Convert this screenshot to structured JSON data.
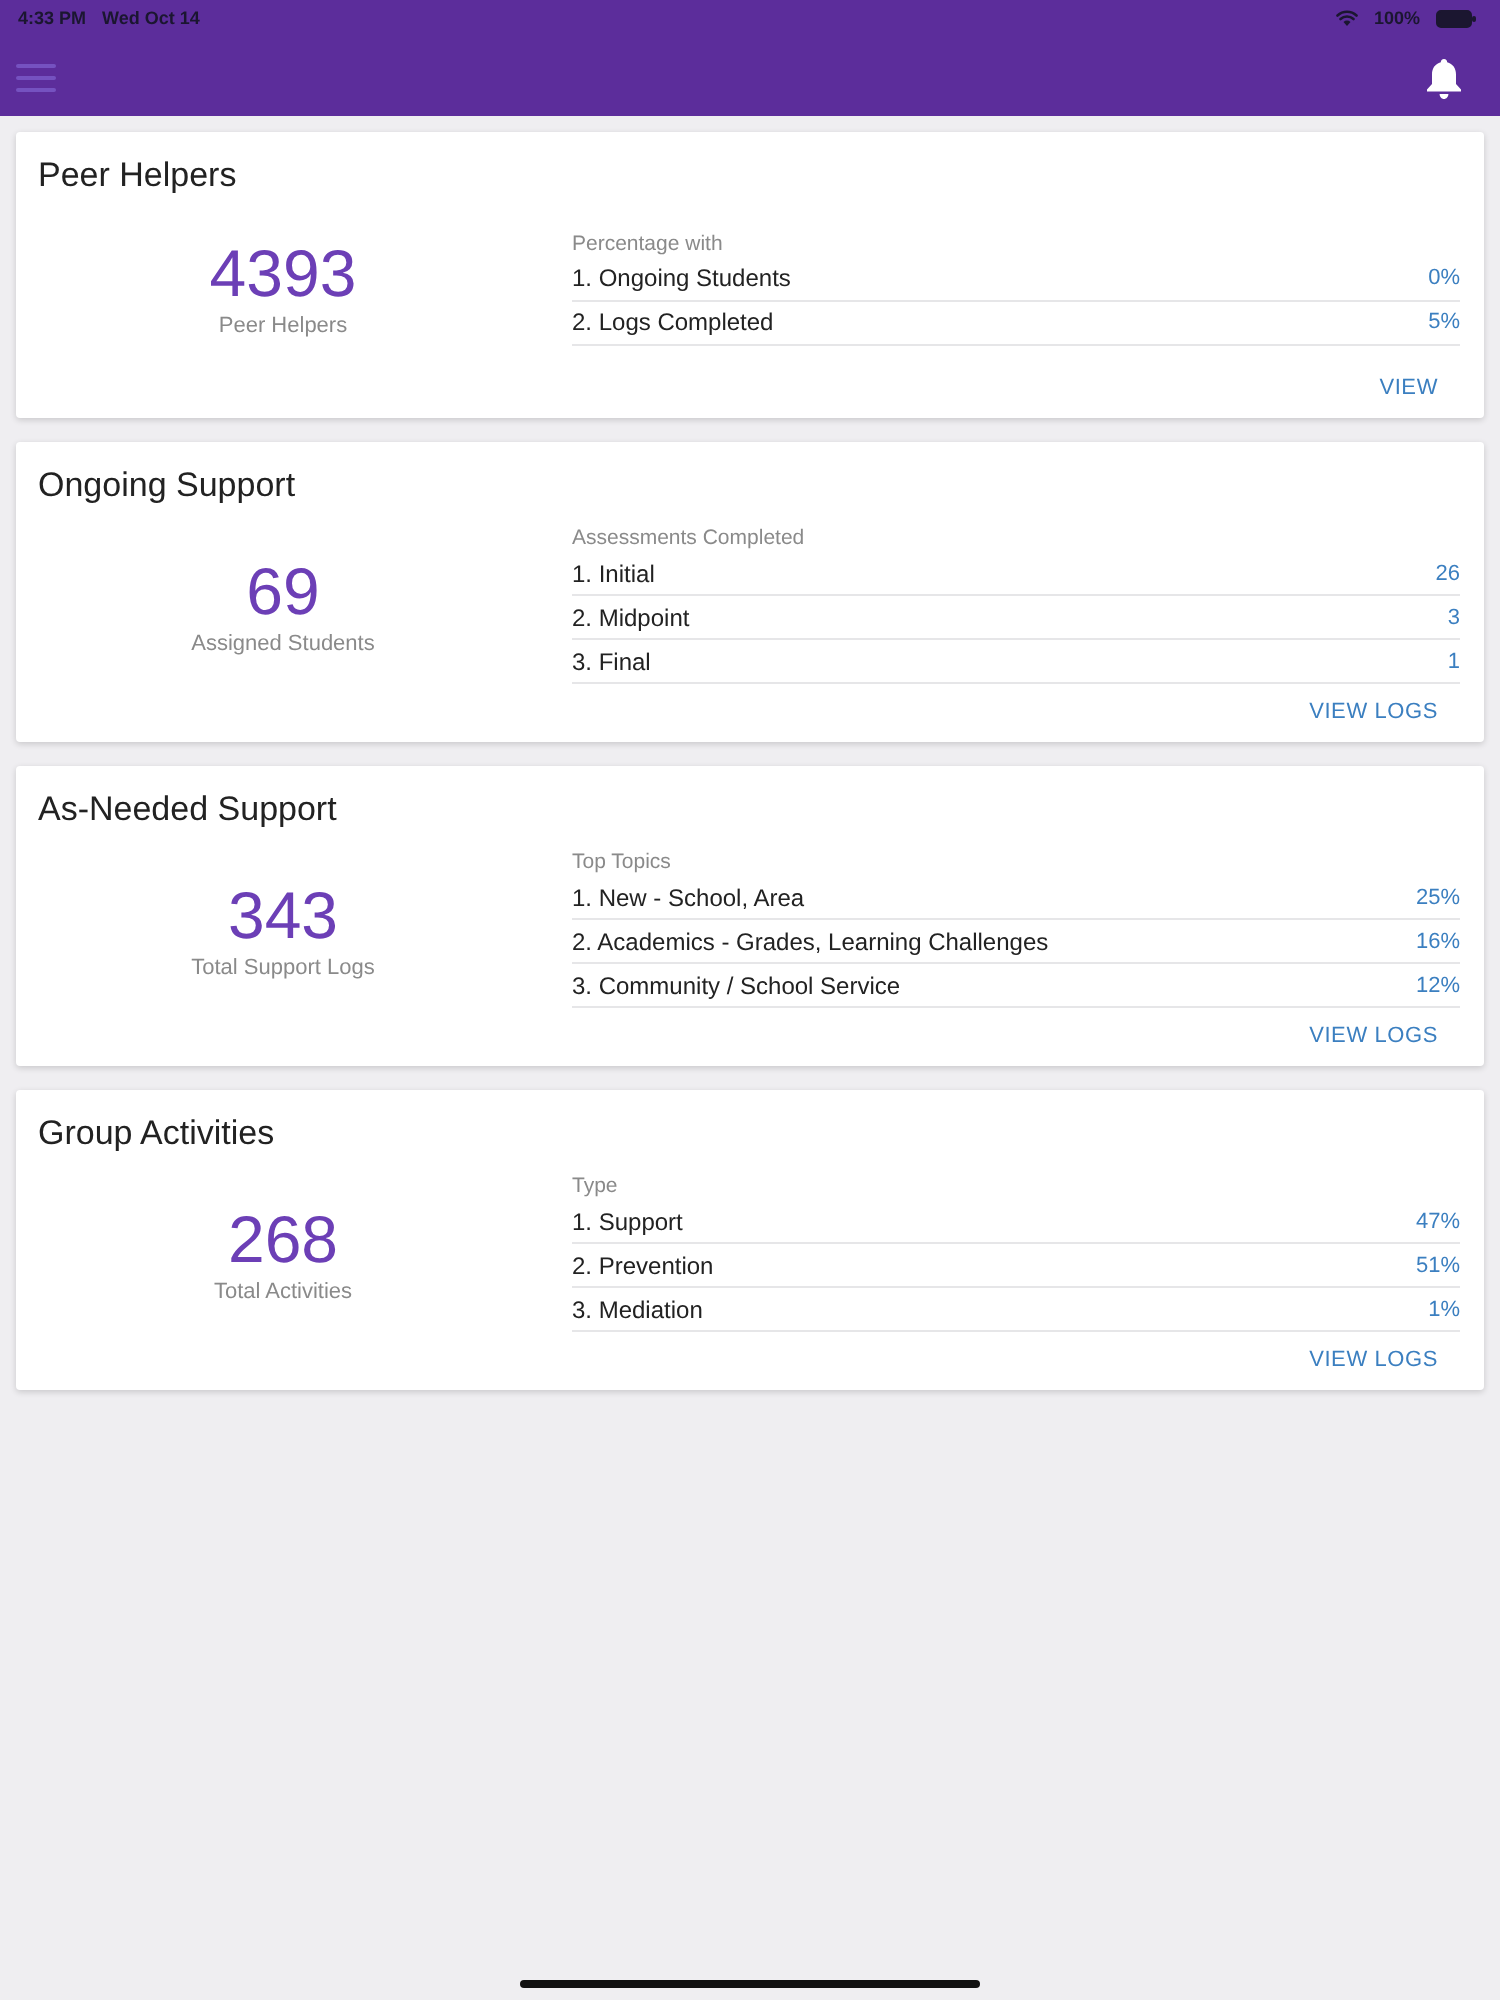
{
  "status_bar": {
    "time": "4:33 PM",
    "date": "Wed Oct 14",
    "battery": "100%"
  },
  "cards": [
    {
      "title": "Peer Helpers",
      "total": "4393",
      "total_label": "Peer Helpers",
      "list_title": "Percentage with",
      "rows": [
        {
          "label": "1. Ongoing Students",
          "value": "0%"
        },
        {
          "label": "2. Logs Completed",
          "value": "5%"
        }
      ],
      "action": "VIEW"
    },
    {
      "title": "Ongoing Support",
      "total": "69",
      "total_label": "Assigned Students",
      "list_title": "Assessments Completed",
      "rows": [
        {
          "label": "1. Initial",
          "value": "26"
        },
        {
          "label": "2. Midpoint",
          "value": "3"
        },
        {
          "label": "3. Final",
          "value": "1"
        }
      ],
      "action": "VIEW LOGS"
    },
    {
      "title": "As-Needed Support",
      "total": "343",
      "total_label": "Total Support Logs",
      "list_title": "Top Topics",
      "rows": [
        {
          "label": "1. New - School, Area",
          "value": "25%"
        },
        {
          "label": "2. Academics - Grades, Learning Challenges",
          "value": "16%"
        },
        {
          "label": "3. Community / School Service",
          "value": "12%"
        }
      ],
      "action": "VIEW LOGS"
    },
    {
      "title": "Group Activities",
      "total": "268",
      "total_label": "Total Activities",
      "list_title": "Type",
      "rows": [
        {
          "label": "1. Support",
          "value": "47%"
        },
        {
          "label": "2. Prevention",
          "value": "51%"
        },
        {
          "label": "3. Mediation",
          "value": "1%"
        }
      ],
      "action": "VIEW LOGS"
    }
  ]
}
